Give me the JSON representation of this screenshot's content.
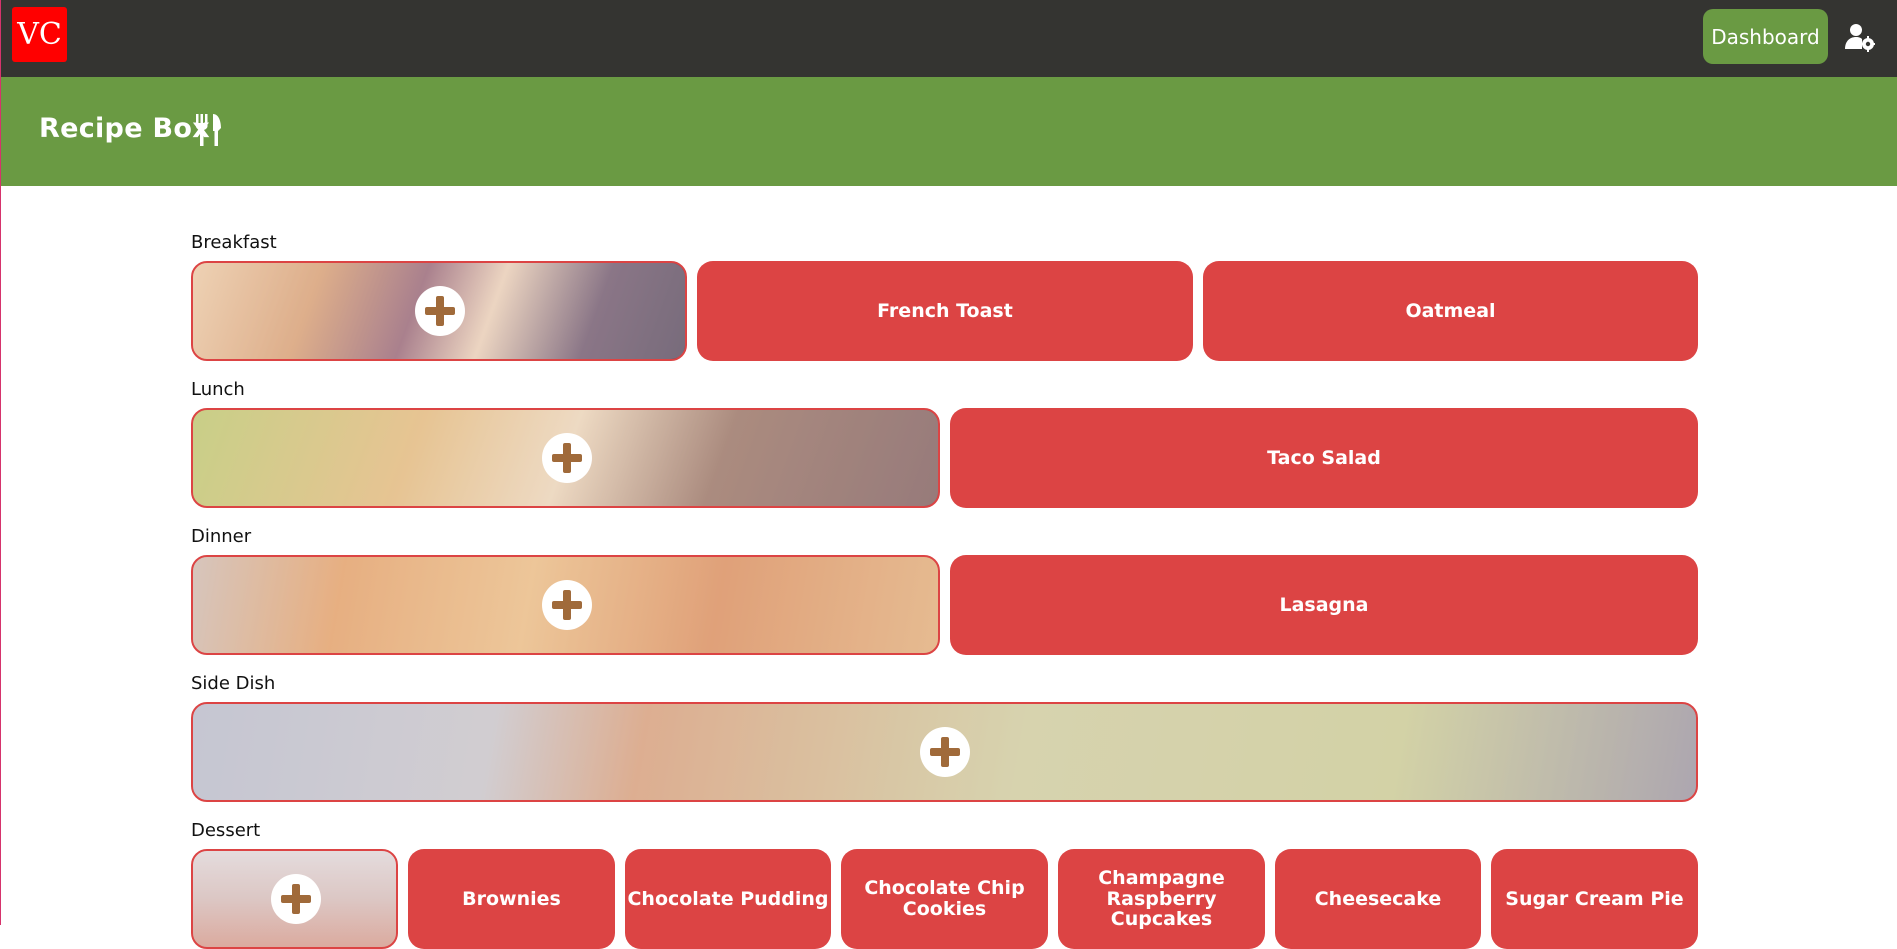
{
  "header": {
    "logo_text": "VC",
    "dashboard_label": "Dashboard",
    "user_icon": "user-cog-icon"
  },
  "banner": {
    "title": "Recipe Box",
    "icon": "utensils-icon"
  },
  "sections": [
    {
      "label": "Breakfast",
      "recipes": [
        "French Toast",
        "Oatmeal"
      ]
    },
    {
      "label": "Lunch",
      "recipes": [
        "Taco Salad"
      ]
    },
    {
      "label": "Dinner",
      "recipes": [
        "Lasagna"
      ]
    },
    {
      "label": "Side Dish",
      "recipes": []
    },
    {
      "label": "Dessert",
      "recipes": [
        "Brownies",
        "Chocolate Pudding",
        "Chocolate Chip Cookies",
        "Champagne Raspberry Cupcakes",
        "Cheesecake",
        "Sugar Cream Pie"
      ]
    }
  ],
  "colors": {
    "topbar": "#343431",
    "accent_green": "#6a9a43",
    "card_red": "#dc4444",
    "logo_red": "#ff0000"
  }
}
